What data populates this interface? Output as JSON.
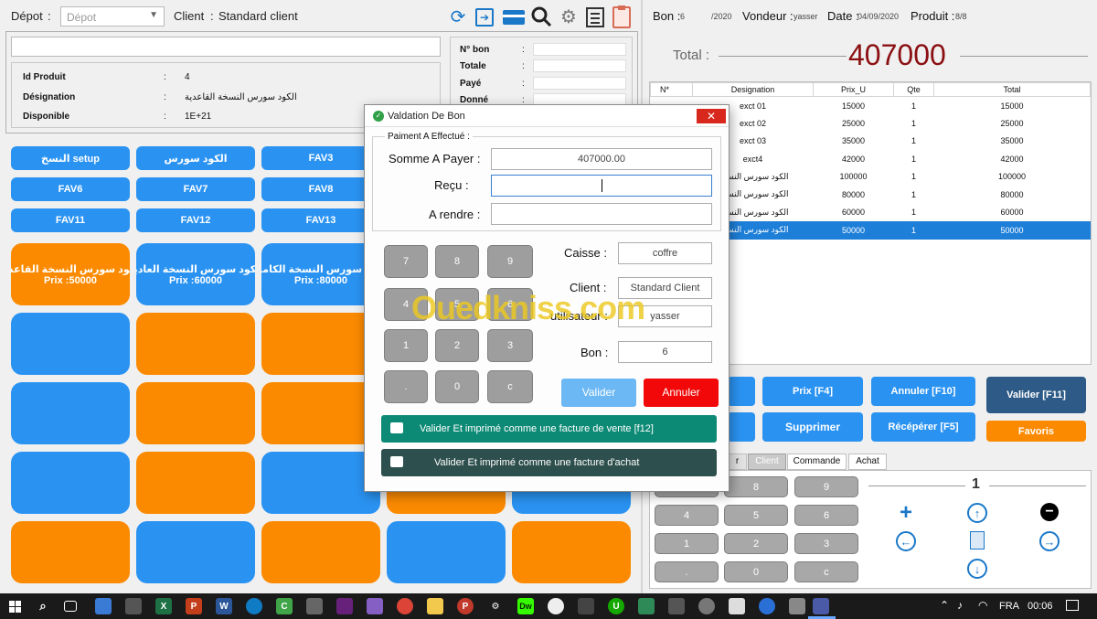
{
  "header": {
    "depot_label": "Dépot",
    "depot_value": "Dépot",
    "client_label": "Client",
    "client_sep": ":",
    "client_value": "Standard client"
  },
  "product": {
    "id_label": "Id Produit",
    "id_value": "4",
    "designation_label": "Désignation",
    "designation_value": "الكود سورس النسخة القاعدية",
    "disponible_label": "Disponible",
    "disponible_value": "1E+21",
    "sep": ":"
  },
  "summary": {
    "n_bon_label": "N° bon",
    "totale_label": "Totale",
    "paye_label": "Payé",
    "donne_label": "Donné",
    "sep": ":"
  },
  "fav_buttons": [
    "النسخ setup",
    "الكود سورس",
    "FAV3",
    "FAV6",
    "FAV7",
    "FAV8",
    "FAV11",
    "FAV12",
    "FAV13"
  ],
  "product_tiles": [
    {
      "name": "الكود سورس النسخة القاعدية",
      "price": "Prix :50000"
    },
    {
      "name": "الكود سورس النسخة العادية",
      "price": "Prix :60000"
    },
    {
      "name": "الكود سورس النسخة الكاملة",
      "price": "Prix :80000"
    }
  ],
  "bon_info": {
    "bon_label": "Bon :",
    "bon_value": "6",
    "bon_year": "/2020",
    "vendeur_label": "Vondeur :",
    "vendeur_value": "yasser",
    "date_label": "Date :",
    "date_value": "04/09/2020",
    "produit_label": "Produit :",
    "produit_value": "8/8"
  },
  "total": {
    "label": "Total :",
    "value": "407000"
  },
  "lines_table": {
    "headers": [
      "N*",
      "Designation",
      "Prix_U",
      "Qte",
      "Total"
    ],
    "rows": [
      [
        "exct 01",
        "15000",
        "1",
        "15000"
      ],
      [
        "exct 02",
        "25000",
        "1",
        "25000"
      ],
      [
        "exct 03",
        "35000",
        "1",
        "35000"
      ],
      [
        "exct4",
        "42000",
        "1",
        "42000"
      ],
      [
        "الكود سورس النسخة",
        "100000",
        "1",
        "100000"
      ],
      [
        "الكود سورس النسخة",
        "80000",
        "1",
        "80000"
      ],
      [
        "الكود سورس النسخة",
        "60000",
        "1",
        "60000"
      ],
      [
        "الكود سورس النسخة",
        "50000",
        "1",
        "50000"
      ]
    ],
    "selected_index": 7
  },
  "action_buttons": {
    "prix": "Prix [F4]",
    "annuler": "Annuler [F10]",
    "valider": "Valider [F11]",
    "supprimer": "Supprimer",
    "recuperer": "Récépérer [F5]",
    "favoris": "Favoris"
  },
  "tabs": [
    "r",
    "Client",
    "Commande",
    "Achat"
  ],
  "keypad_right": [
    "8",
    "9",
    "4",
    "5",
    "6",
    "1",
    "2",
    "3",
    ".",
    "0",
    "c"
  ],
  "qty_display": "1",
  "dialog": {
    "title": "Valdation De Bon",
    "group_label": "Paiment A Effectué :",
    "somme_label": "Somme A Payer :",
    "somme_value": "407000.00",
    "recu_label": "Reçu :",
    "arendre_label": "A rendre :",
    "keypad": [
      "7",
      "8",
      "9",
      "4",
      "5",
      "6",
      "1",
      "2",
      "3",
      ".",
      "0",
      "c"
    ],
    "caisse_label": "Caisse :",
    "caisse_value": "coffre",
    "client_label": "Client :",
    "client_value": "Standard Client",
    "utilisateur_label": "utilisateur :",
    "utilisateur_value": "yasser",
    "bon_label": "Bon :",
    "bon_value": "6",
    "valider": "Valider",
    "annuler": "Annuler",
    "print_vente": "Valider Et imprimé comme une facture de vente [f12]",
    "print_achat": "Valider Et imprimé comme une facture d'achat"
  },
  "watermark": "Ouedkniss.com",
  "taskbar": {
    "lang": "FRA",
    "time": "00:06"
  },
  "colors": {
    "accent_blue": "#2a93f2",
    "orange": "#fb8a00",
    "total_red": "#8b0f12",
    "teal": "#0d8a75",
    "dark_teal": "#2d4f4d",
    "annuler_red": "#f20808"
  }
}
